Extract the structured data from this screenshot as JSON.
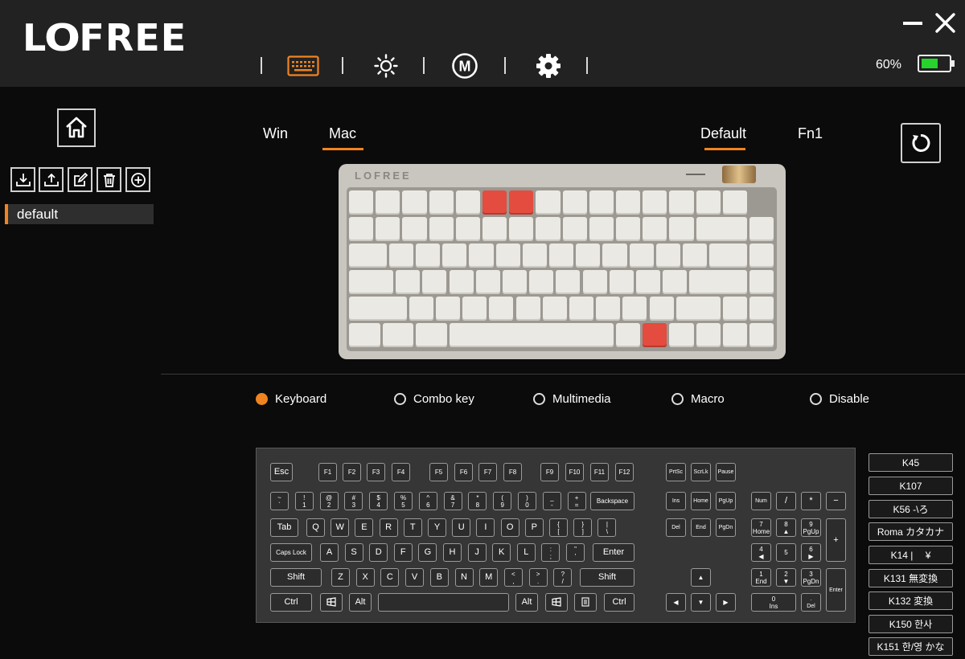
{
  "app": {
    "logo": "LOFREE"
  },
  "colors": {
    "accent": "#f08421",
    "battery": "#27d32d",
    "highlight_key": "#e34c3e"
  },
  "nav": {
    "items": [
      {
        "name": "keyboard-icon",
        "active": true
      },
      {
        "name": "lighting-icon",
        "active": false
      },
      {
        "name": "macro-icon",
        "active": false
      },
      {
        "name": "settings-icon",
        "active": false
      }
    ]
  },
  "window": {
    "minimize": "minimize-icon",
    "close": "close-icon"
  },
  "battery": {
    "percent_label": "60%",
    "level": 0.6
  },
  "sidebar": {
    "tools": [
      "import-icon",
      "export-icon",
      "edit-icon",
      "delete-icon",
      "add-icon"
    ],
    "profiles": [
      {
        "label": "default",
        "selected": true
      }
    ]
  },
  "os_tabs": [
    {
      "label": "Win",
      "active": false
    },
    {
      "label": "Mac",
      "active": true
    }
  ],
  "layer_tabs": [
    {
      "label": "Default",
      "active": true
    },
    {
      "label": "Fn1",
      "active": false
    }
  ],
  "keyboard_image": {
    "brand": "LOFREE"
  },
  "mapping_types": [
    {
      "label": "Keyboard",
      "selected": true
    },
    {
      "label": "Combo key",
      "selected": false
    },
    {
      "label": "Multimedia",
      "selected": false
    },
    {
      "label": "Macro",
      "selected": false
    },
    {
      "label": "Disable",
      "selected": false
    }
  ],
  "virtual_keys": {
    "esc": "Esc",
    "f": [
      "F1",
      "F2",
      "F3",
      "F4",
      "F5",
      "F6",
      "F7",
      "F8",
      "F9",
      "F10",
      "F11",
      "F12"
    ],
    "prtsc": "PrtSc",
    "scrlk": "ScrLk",
    "pause": "Pause",
    "num_row": [
      "~\n`",
      "!\n1",
      "@\n2",
      "#\n3",
      "$\n4",
      "%\n5",
      "^\n6",
      "&\n7",
      "*\n8",
      "(\n9",
      ")\n0",
      "_\n-",
      "+\n="
    ],
    "backspace": "Backspace",
    "ins": "Ins",
    "home": "Home",
    "pgup": "PgUp",
    "numlock": "Num",
    "slash": "/",
    "star": "*",
    "minus": "−",
    "tab": "Tab",
    "q_row": [
      "Q",
      "W",
      "E",
      "R",
      "T",
      "Y",
      "U",
      "I",
      "O",
      "P",
      "{\n[",
      "}\n]",
      "|\n\\"
    ],
    "del": "Del",
    "end": "End",
    "pgdn": "PgDn",
    "np7": "7\nHome",
    "np8": "8\n▲",
    "np9": "9\nPgUp",
    "plus": "+",
    "caps": "Caps Lock",
    "a_row": [
      "A",
      "S",
      "D",
      "F",
      "G",
      "H",
      "J",
      "K",
      "L",
      ":\n;",
      "\"\n'"
    ],
    "enter": "Enter",
    "np4": "4\n◀",
    "np5": "5",
    "np6": "6\n▶",
    "shift": "Shift",
    "z_row": [
      "Z",
      "X",
      "C",
      "V",
      "B",
      "N",
      "M",
      "<\n,",
      ">\n.",
      "?\n/"
    ],
    "rshift": "Shift",
    "up": "▲",
    "np1": "1\nEnd",
    "np2": "2\n▼",
    "np3": "3\nPgDn",
    "npenter": "Enter",
    "ctrl": "Ctrl",
    "alt": "Alt",
    "ralt": "Alt",
    "rctrl": "Ctrl",
    "left": "◀",
    "down": "▼",
    "right": "▶",
    "np0": "0\nIns",
    "npdot": ".\nDel"
  },
  "extra_keys": [
    "K45",
    "K107",
    "K56 -\\ろ",
    "Roma カタカナ",
    "K14 |　 ¥",
    "K131 無変換",
    "K132 変換",
    "K150 한사",
    "K151 한/영 かな"
  ]
}
